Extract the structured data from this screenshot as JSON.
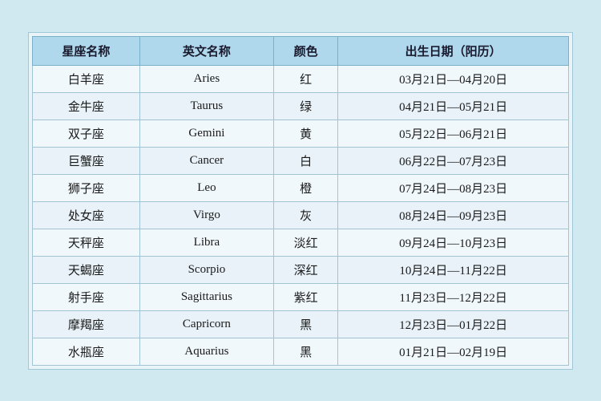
{
  "table": {
    "headers": [
      "星座名称",
      "英文名称",
      "颜色",
      "出生日期（阳历）"
    ],
    "rows": [
      {
        "chinese": "白羊座",
        "english": "Aries",
        "color": "红",
        "date": "03月21日—04月20日"
      },
      {
        "chinese": "金牛座",
        "english": "Taurus",
        "color": "绿",
        "date": "04月21日—05月21日"
      },
      {
        "chinese": "双子座",
        "english": "Gemini",
        "color": "黄",
        "date": "05月22日—06月21日"
      },
      {
        "chinese": "巨蟹座",
        "english": "Cancer",
        "color": "白",
        "date": "06月22日—07月23日"
      },
      {
        "chinese": "狮子座",
        "english": "Leo",
        "color": "橙",
        "date": "07月24日—08月23日"
      },
      {
        "chinese": "处女座",
        "english": "Virgo",
        "color": "灰",
        "date": "08月24日—09月23日"
      },
      {
        "chinese": "天秤座",
        "english": "Libra",
        "color": "淡红",
        "date": "09月24日—10月23日"
      },
      {
        "chinese": "天蝎座",
        "english": "Scorpio",
        "color": "深红",
        "date": "10月24日—11月22日"
      },
      {
        "chinese": "射手座",
        "english": "Sagittarius",
        "color": "紫红",
        "date": "11月23日—12月22日"
      },
      {
        "chinese": "摩羯座",
        "english": "Capricorn",
        "color": "黑",
        "date": "12月23日—01月22日"
      },
      {
        "chinese": "水瓶座",
        "english": "Aquarius",
        "color": "黑",
        "date": "01月21日—02月19日"
      }
    ]
  }
}
